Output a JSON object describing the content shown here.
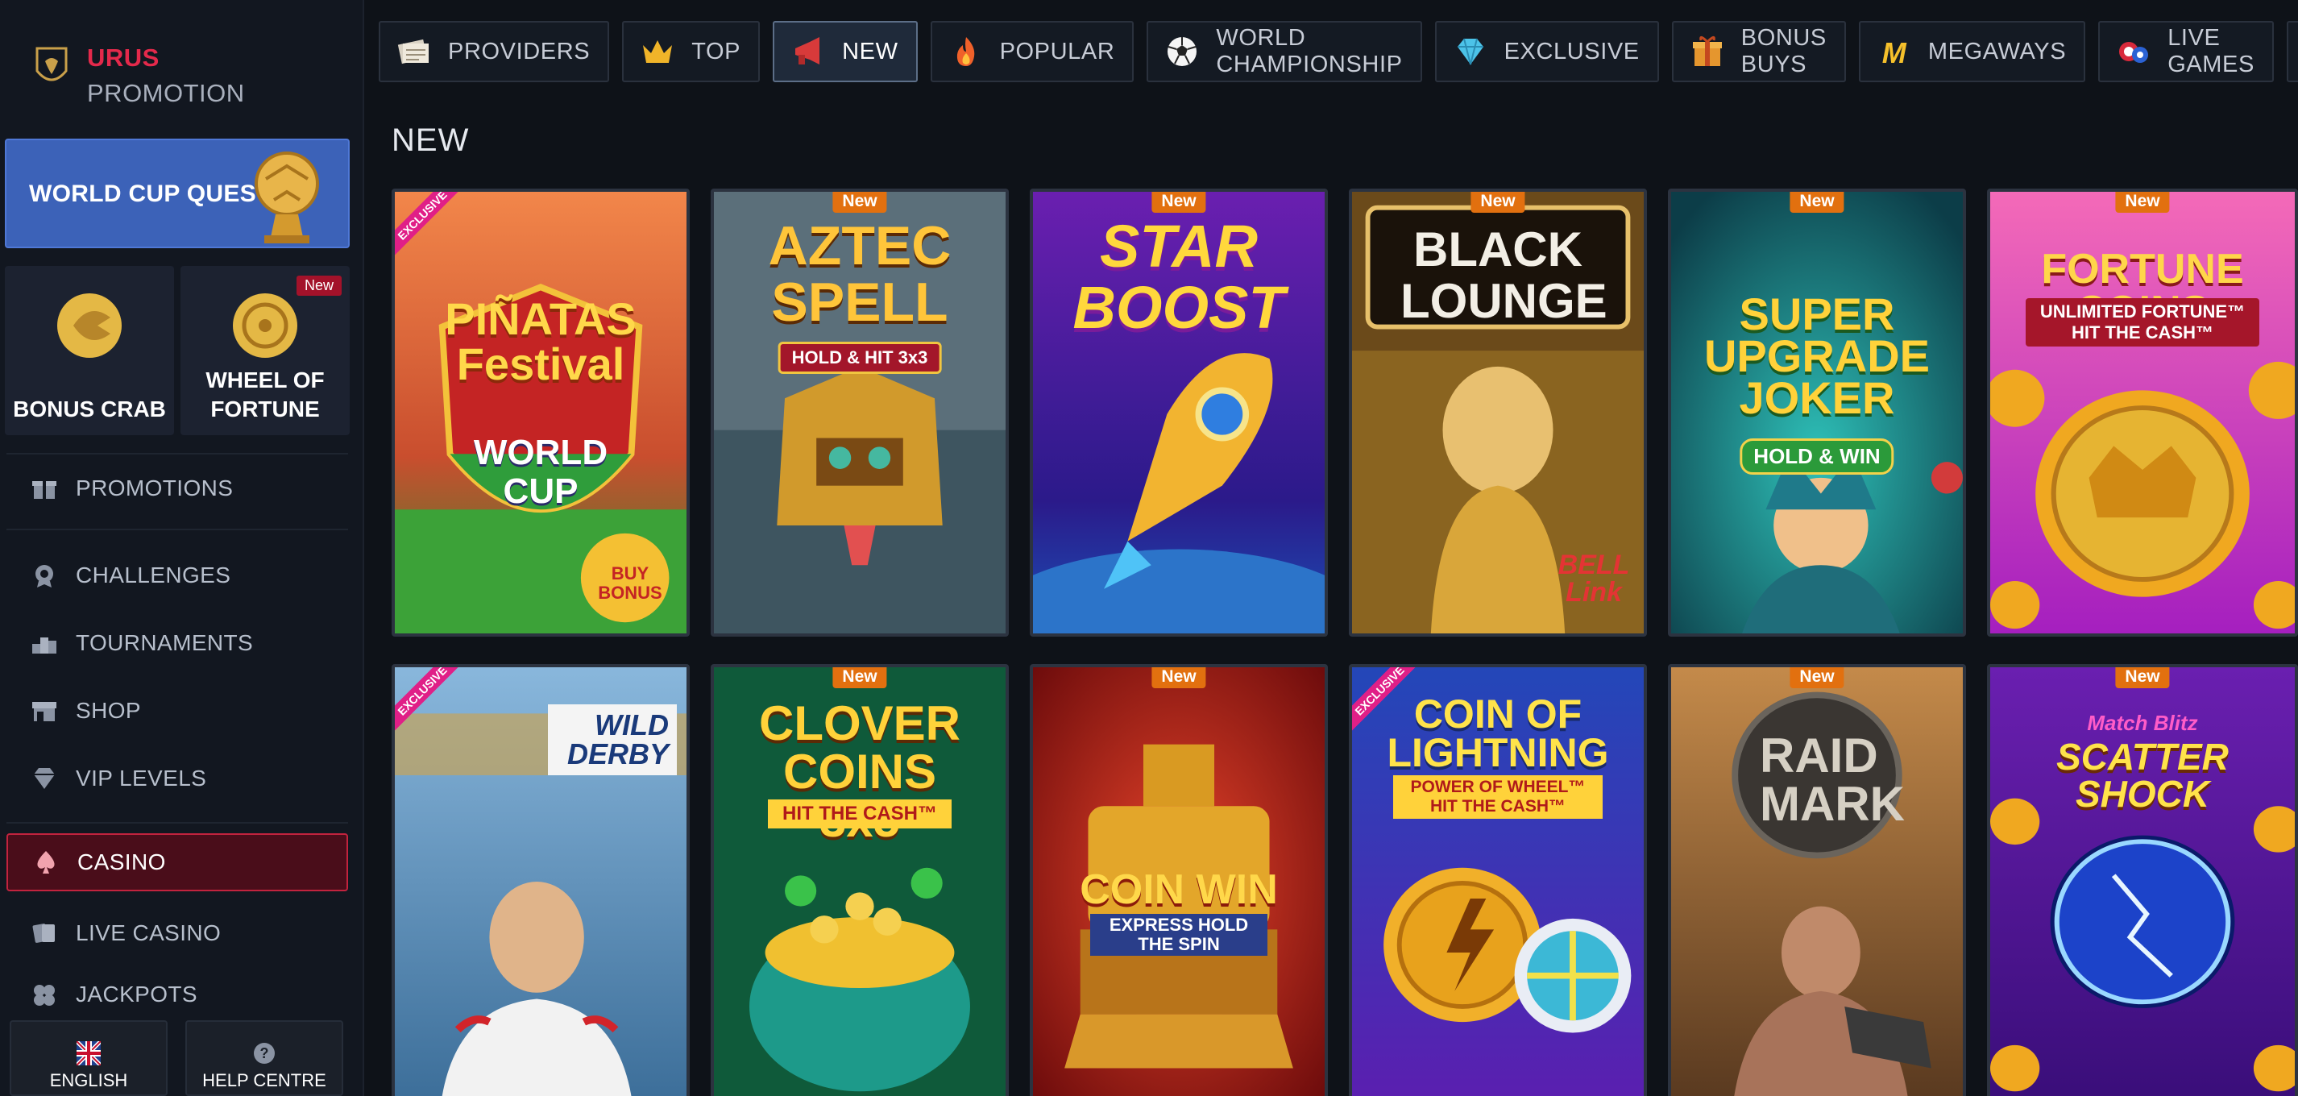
{
  "brand": {
    "top": "URUS",
    "bottom": "PROMOTION"
  },
  "quest": {
    "label": "WORLD CUP QUEST"
  },
  "tiles": [
    {
      "label": "BONUS CRAB",
      "badge": ""
    },
    {
      "label": "WHEEL OF FORTUNE",
      "badge": "New"
    }
  ],
  "nav": {
    "items": [
      {
        "label": "PROMOTIONS",
        "icon": "gift-icon"
      },
      {
        "label": "CHALLENGES",
        "icon": "badge-icon"
      },
      {
        "label": "TOURNAMENTS",
        "icon": "podium-icon"
      },
      {
        "label": "SHOP",
        "icon": "shop-icon"
      },
      {
        "label": "VIP LEVELS",
        "icon": "diamond-icon"
      },
      {
        "label": "CASINO",
        "icon": "spade-icon"
      },
      {
        "label": "LIVE CASINO",
        "icon": "cards-icon"
      },
      {
        "label": "JACKPOTS",
        "icon": "clover-icon"
      }
    ]
  },
  "footer": {
    "language": "ENGLISH",
    "help": "HELP CENTRE"
  },
  "categories": [
    {
      "label": "PROVIDERS",
      "icon": "providers-icon"
    },
    {
      "label": "TOP",
      "icon": "crown-icon"
    },
    {
      "label": "NEW",
      "icon": "megaphone-icon"
    },
    {
      "label": "POPULAR",
      "icon": "fire-icon"
    },
    {
      "label": "WORLD CHAMPIONSHIP",
      "icon": "soccer-ball-icon"
    },
    {
      "label": "EXCLUSIVE",
      "icon": "gem-icon"
    },
    {
      "label": "BONUS BUYS",
      "icon": "gift-box-icon"
    },
    {
      "label": "MEGAWAYS",
      "icon": "megaways-icon"
    },
    {
      "label": "LIVE GAMES",
      "icon": "chips-icon"
    }
  ],
  "section_title": "NEW",
  "games": [
    {
      "title": "PIÑATAS Festival",
      "sub": "WORLD CUP",
      "badge": "",
      "exclusive": "EXCLUSIVE",
      "extra": "BUY BONUS"
    },
    {
      "title": "AZTEC SPELL",
      "sub": "HOLD & HIT 3x3",
      "badge": "New",
      "exclusive": ""
    },
    {
      "title": "STAR BOOST",
      "sub": "",
      "badge": "New",
      "exclusive": ""
    },
    {
      "title": "BLACK LOUNGE",
      "sub": "BELL Link",
      "badge": "New",
      "exclusive": ""
    },
    {
      "title": "SUPER UPGRADE JOKER",
      "sub": "HOLD & WIN",
      "badge": "New",
      "exclusive": ""
    },
    {
      "title": "FORTUNE COINS",
      "sub": "UNLIMITED FORTUNE™ HIT THE CASH™",
      "badge": "New",
      "exclusive": ""
    },
    {
      "title": "WILD DERBY",
      "sub": "",
      "badge": "",
      "exclusive": "EXCLUSIVE"
    },
    {
      "title": "CLOVER COINS 3x5",
      "sub": "HIT THE CASH™",
      "badge": "New",
      "exclusive": ""
    },
    {
      "title": "COIN WIN",
      "sub": "EXPRESS HOLD THE SPIN",
      "badge": "New",
      "exclusive": ""
    },
    {
      "title": "COIN OF LIGHTNING 2",
      "sub": "POWER OF WHEEL™ HIT THE CASH™",
      "badge": "",
      "exclusive": "EXCLUSIVE"
    },
    {
      "title": "RAID MARK",
      "sub": "",
      "badge": "New",
      "exclusive": ""
    },
    {
      "title": "SCATTER SHOCK",
      "sub": "Match Blitz",
      "badge": "New",
      "exclusive": ""
    }
  ],
  "colors": {
    "accent": "#e4294b",
    "quest_bg": "#3c62b8",
    "badge": "#e2700f",
    "exclusive": "#e01f87"
  }
}
